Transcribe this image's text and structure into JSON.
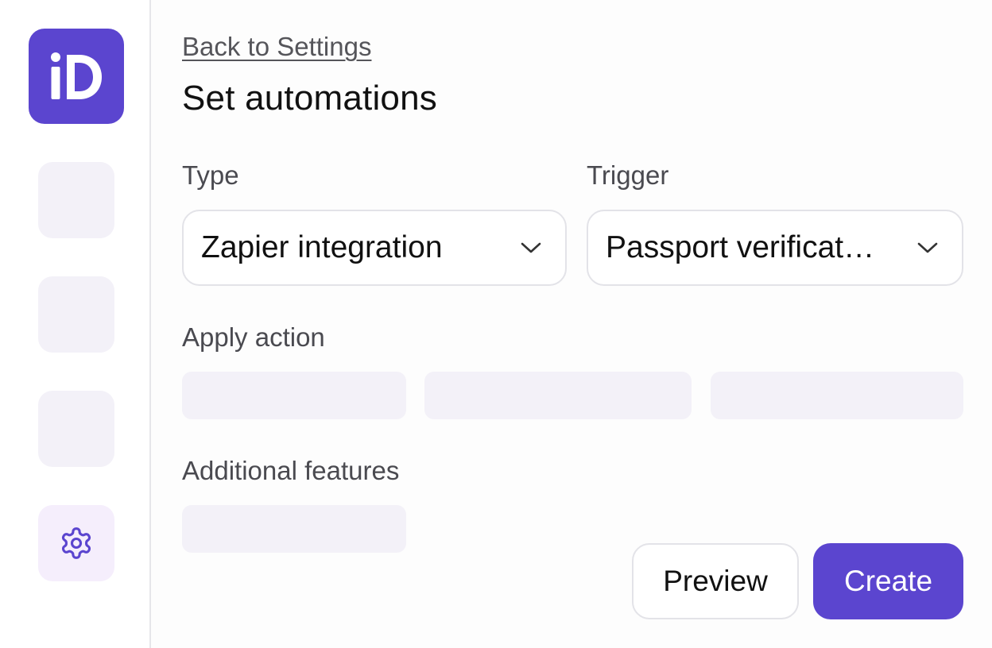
{
  "app": {
    "logo_text": "iD",
    "accent_color": "#5b45cf"
  },
  "sidebar": {
    "items": [
      {
        "icon": "placeholder"
      },
      {
        "icon": "placeholder"
      },
      {
        "icon": "placeholder"
      },
      {
        "icon": "gear-icon"
      }
    ]
  },
  "header": {
    "back_link": "Back to Settings",
    "title": "Set automations"
  },
  "form": {
    "type": {
      "label": "Type",
      "value": "Zapier integration"
    },
    "trigger": {
      "label": "Trigger",
      "value": "Passport verificat…"
    },
    "apply_action": {
      "label": "Apply action"
    },
    "additional_features": {
      "label": "Additional features"
    }
  },
  "actions": {
    "preview_label": "Preview",
    "create_label": "Create"
  }
}
